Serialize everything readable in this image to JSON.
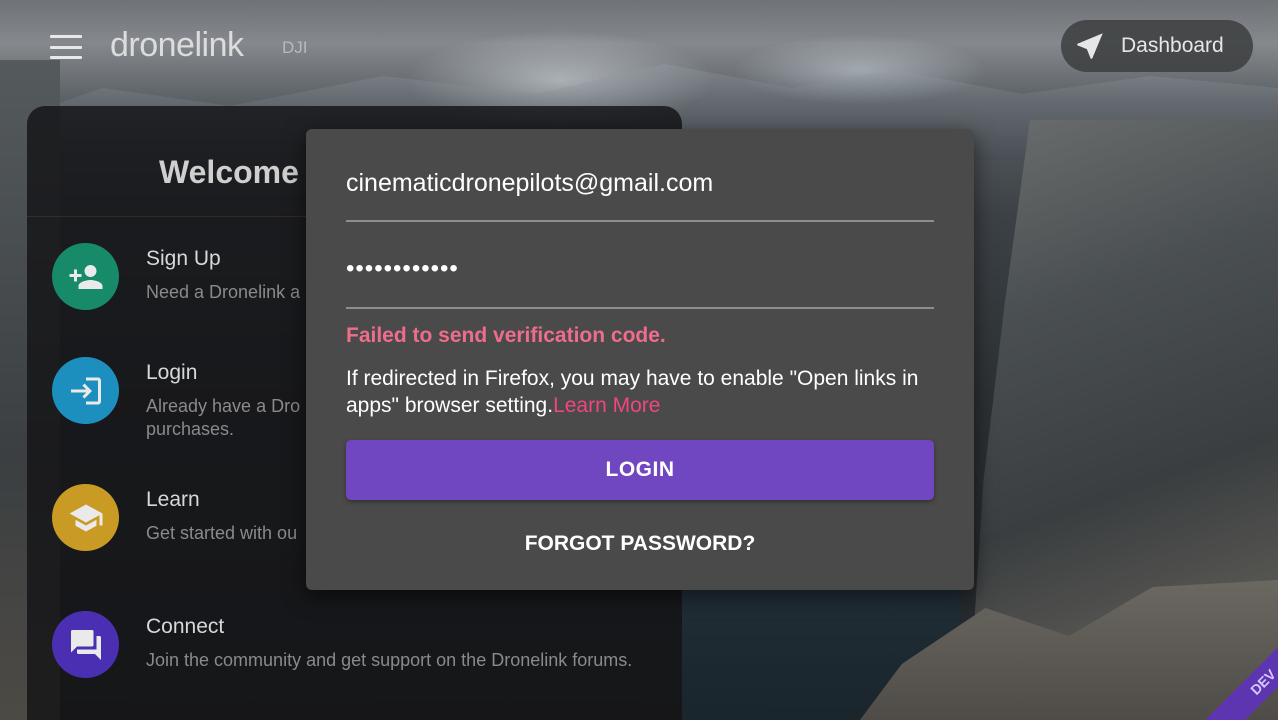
{
  "header": {
    "brand": "dronelink",
    "brand_sub": "DJI",
    "dashboard_label": "Dashboard"
  },
  "welcome": {
    "title": "Welcome t",
    "items": [
      {
        "title": "Sign Up",
        "desc": "Need a Dronelink a",
        "color": "#178a6a",
        "icon": "person-add-icon"
      },
      {
        "title": "Login",
        "desc": "Already have a Dro\npurchases.",
        "color": "#1d8fbe",
        "icon": "login-icon"
      },
      {
        "title": "Learn",
        "desc": "Get started with ou",
        "color": "#c99a24",
        "icon": "school-icon"
      },
      {
        "title": "Connect",
        "desc": "Join the community and get support on the Dronelink forums.",
        "color": "#4b2fb3",
        "icon": "forum-icon"
      }
    ]
  },
  "dialog": {
    "email_value": "cinematicdronepilots@gmail.com",
    "password_value": "••••••••••••",
    "error": "Failed to send verification code.",
    "info_text": "If redirected in Firefox, you may have to enable \"Open links in apps\" browser setting.",
    "learn_more": "Learn More",
    "login_label": "LOGIN",
    "forgot_label": "FORGOT PASSWORD?"
  },
  "ribbon": {
    "label": "DEV"
  },
  "colors": {
    "accent": "#7146c1",
    "error": "#ee6d8a",
    "link": "#f0467d"
  }
}
